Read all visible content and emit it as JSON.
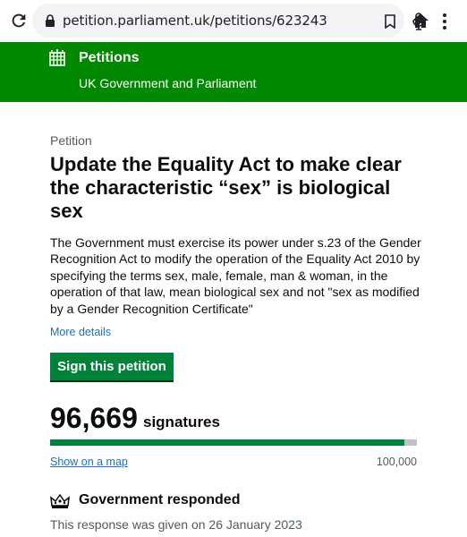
{
  "browser": {
    "url": "petition.parliament.uk/petitions/623243"
  },
  "header": {
    "brand": "Petitions",
    "org": "UK Government and Parliament"
  },
  "petition": {
    "eyebrow": "Petition",
    "title": "Update the Equality Act to make clear the characteristic “sex” is biological sex",
    "description": "The Government must exercise its power under s.23 of the Gender Recognition Act to modify the operation of the Equality Act 2010 by specifying the terms sex, male, female, man & woman, in the operation of that law, mean biological sex and not \"sex as modified by a Gender Recognition Certificate\"",
    "more_details": "More details",
    "sign_label": "Sign this petition",
    "signature_count": "96,669",
    "signature_label": "signatures",
    "progress_fraction": 0.96669,
    "map_link": "Show on a map",
    "target": "100,000"
  },
  "government": {
    "title": "Government responded",
    "response_date": "This response was given on 26 January 2023"
  },
  "colors": {
    "header_green": "#008800",
    "button_green": "#00823b",
    "link_blue": "#1d70b8"
  }
}
